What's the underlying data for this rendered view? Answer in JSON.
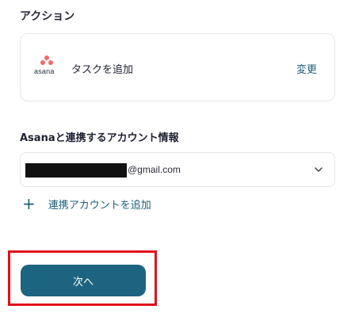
{
  "section": {
    "title": "アクション"
  },
  "action": {
    "app_logo_text": "asana",
    "app_icon": "asana-logo-icon",
    "name": "タスクを追加",
    "change_label": "変更"
  },
  "account": {
    "label": "Asanaと連携するアカウント情報",
    "selected_email_domain": "@gmail.com",
    "dropdown_icon": "chevron-down-icon",
    "add_account_label": "連携アカウントを追加",
    "add_icon": "plus-icon"
  },
  "footer": {
    "next_label": "次へ"
  },
  "colors": {
    "accent": "#1d6480",
    "link": "#1f5f7a",
    "highlight": "#e0101a",
    "asana_brand": "#f06a6a"
  }
}
